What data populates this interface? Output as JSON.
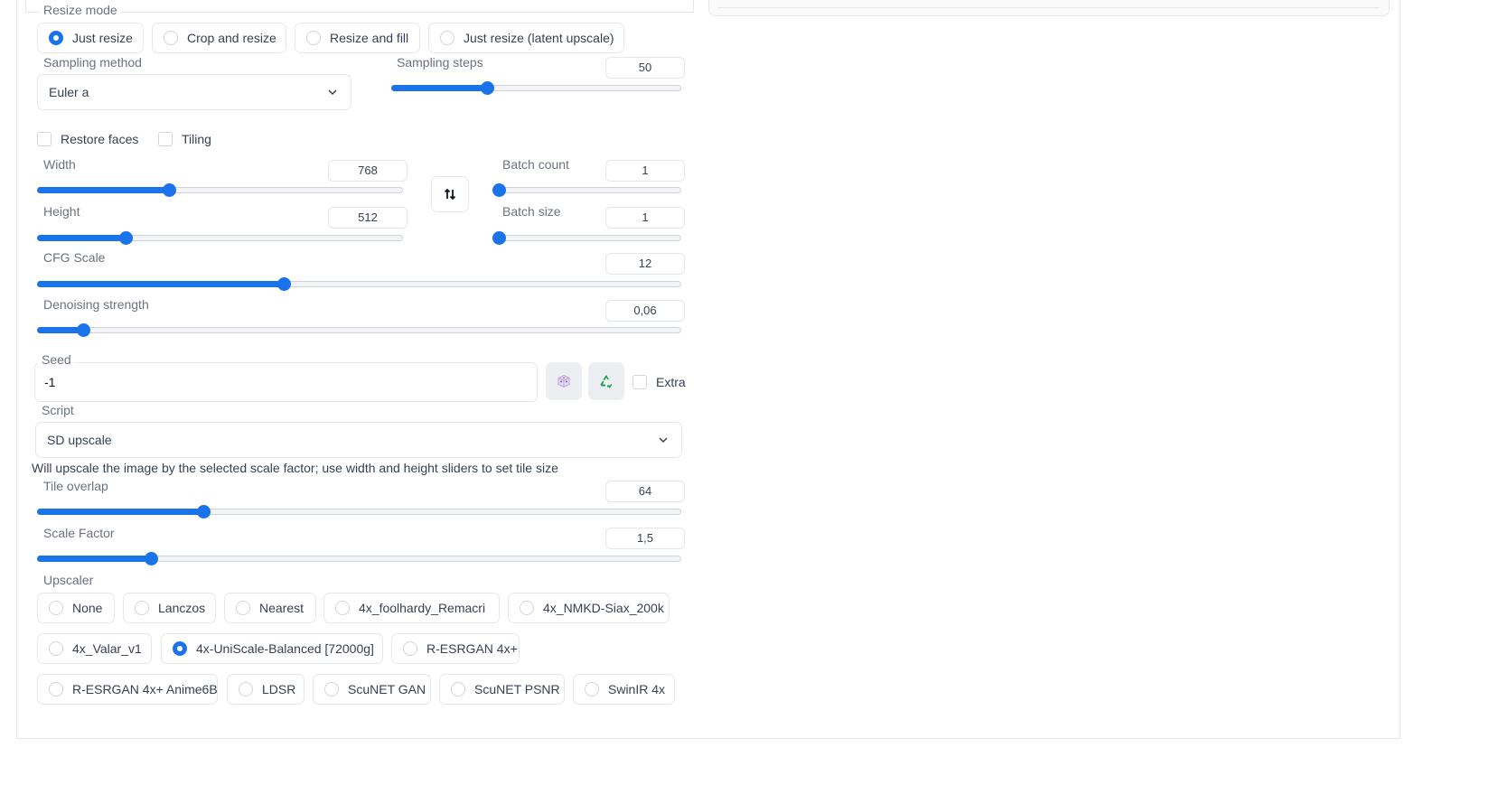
{
  "resize_mode": {
    "legend": "Resize mode",
    "options": [
      {
        "label": "Just resize",
        "selected": true
      },
      {
        "label": "Crop and resize",
        "selected": false
      },
      {
        "label": "Resize and fill",
        "selected": false
      },
      {
        "label": "Just resize (latent upscale)",
        "selected": false
      }
    ]
  },
  "sampling_method": {
    "label": "Sampling method",
    "value": "Euler a"
  },
  "sampling_steps": {
    "label": "Sampling steps",
    "value": "50",
    "fraction": 0.33
  },
  "restore_faces": {
    "label": "Restore faces",
    "checked": false
  },
  "tiling": {
    "label": "Tiling",
    "checked": false
  },
  "width": {
    "label": "Width",
    "value": "768",
    "fraction": 0.36
  },
  "height": {
    "label": "Height",
    "value": "512",
    "fraction": 0.24
  },
  "batch_count": {
    "label": "Batch count",
    "value": "1",
    "fraction": 0.0
  },
  "batch_size": {
    "label": "Batch size",
    "value": "1",
    "fraction": 0.0
  },
  "swap_icon": "swap-vertical-icon",
  "cfg_scale": {
    "label": "CFG Scale",
    "value": "12",
    "fraction": 0.383
  },
  "denoising": {
    "label": "Denoising strength",
    "value": "0,06",
    "fraction": 0.07
  },
  "seed": {
    "legend": "Seed",
    "value": "-1",
    "dice_icon": "dice-icon",
    "recycle_icon": "recycle-icon",
    "extra_label": "Extra"
  },
  "script": {
    "label": "Script",
    "value": "SD upscale"
  },
  "script_note": "Will upscale the image by the selected scale factor; use width and height sliders to set tile size",
  "tile_overlap": {
    "label": "Tile overlap",
    "value": "64",
    "fraction": 0.258
  },
  "scale_factor": {
    "label": "Scale Factor",
    "value": "1,5",
    "fraction": 0.176
  },
  "upscaler": {
    "label": "Upscaler",
    "options": [
      {
        "label": "None",
        "selected": false
      },
      {
        "label": "Lanczos",
        "selected": false
      },
      {
        "label": "Nearest",
        "selected": false
      },
      {
        "label": "4x_foolhardy_Remacri",
        "selected": false
      },
      {
        "label": "4x_NMKD-Siax_200k",
        "selected": false
      },
      {
        "label": "4x_Valar_v1",
        "selected": false
      },
      {
        "label": "4x-UniScale-Balanced [72000g]",
        "selected": true
      },
      {
        "label": "R-ESRGAN 4x+",
        "selected": false
      },
      {
        "label": "R-ESRGAN 4x+ Anime6B",
        "selected": false
      },
      {
        "label": "LDSR",
        "selected": false
      },
      {
        "label": "ScuNET GAN",
        "selected": false
      },
      {
        "label": "ScuNET PSNR",
        "selected": false
      },
      {
        "label": "SwinIR 4x",
        "selected": false
      }
    ]
  },
  "colors": {
    "accent": "#1a73e8",
    "border": "#e5e7eb",
    "recycle": "#16a34a"
  }
}
